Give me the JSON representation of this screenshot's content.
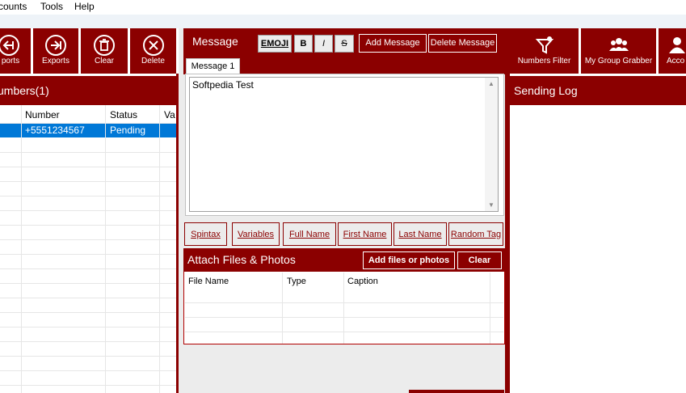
{
  "menu": {
    "accounts": "counts",
    "tools": "Tools",
    "help": "Help"
  },
  "toolbar_left": [
    {
      "label": "ports",
      "icon": "import-icon"
    },
    {
      "label": "Exports",
      "icon": "export-icon"
    },
    {
      "label": "Clear",
      "icon": "trash-icon"
    },
    {
      "label": "Delete",
      "icon": "close-circle-icon"
    }
  ],
  "numbers_panel": {
    "title": "umbers(1)",
    "columns": [
      "Number",
      "Status",
      "Va"
    ],
    "rows": [
      {
        "number": "+5551234567",
        "status": "Pending",
        "va": ""
      }
    ]
  },
  "message_panel": {
    "title": "Message",
    "format_buttons": {
      "emoji": "EMOJI",
      "bold": "B",
      "italic": "I",
      "strike": "S"
    },
    "add_message": "Add Message",
    "delete_message": "Delete Message",
    "tab": "Message 1",
    "text": "Softpedia Test",
    "tokens": [
      "Spintax",
      "Variables",
      "Full Name",
      "First Name",
      "Last Name",
      "Random Tag"
    ]
  },
  "attach_panel": {
    "title": "Attach Files & Photos",
    "add_button": "Add files or photos",
    "clear_button": "Clear",
    "columns": [
      "File Name",
      "Type",
      "Caption"
    ]
  },
  "toolbar_right": [
    {
      "label": "Numbers Filter",
      "icon": "filter-icon"
    },
    {
      "label": "My Group Grabber",
      "icon": "group-icon"
    },
    {
      "label": "Acco",
      "icon": "user-icon"
    }
  ],
  "sending_log": {
    "title": "Sending Log"
  },
  "colors": {
    "accent": "#8b0000",
    "selection": "#0078d7"
  }
}
